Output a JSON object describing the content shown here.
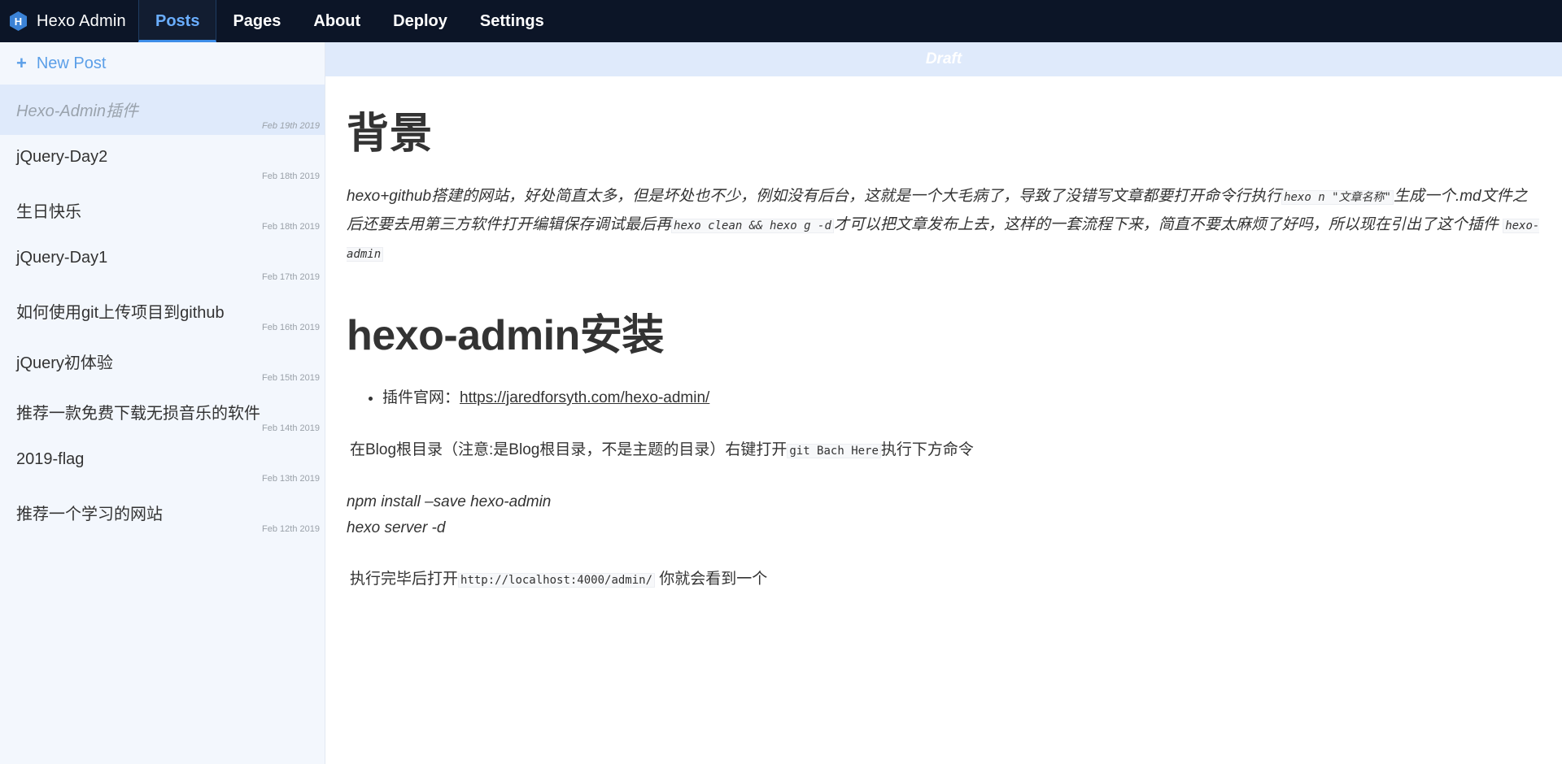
{
  "app": {
    "title": "Hexo Admin"
  },
  "nav": {
    "items": [
      "Posts",
      "Pages",
      "About",
      "Deploy",
      "Settings"
    ],
    "active": "Posts"
  },
  "sidebar": {
    "new_post_label": "New Post",
    "posts": [
      {
        "title": "Hexo-Admin插件",
        "date": "Feb 19th 2019",
        "selected": true
      },
      {
        "title": "jQuery-Day2",
        "date": "Feb 18th 2019"
      },
      {
        "title": "生日快乐",
        "date": "Feb 18th 2019"
      },
      {
        "title": "jQuery-Day1",
        "date": "Feb 17th 2019"
      },
      {
        "title": "如何使用git上传项目到github",
        "date": "Feb 16th 2019"
      },
      {
        "title": "jQuery初体验",
        "date": "Feb 15th 2019"
      },
      {
        "title": "推荐一款免费下载无损音乐的软件",
        "date": "Feb 14th 2019"
      },
      {
        "title": "2019-flag",
        "date": "Feb 13th 2019"
      },
      {
        "title": "推荐一个学习的网站",
        "date": "Feb 12th 2019"
      }
    ]
  },
  "editor": {
    "status": "Draft",
    "heading1": "背景",
    "paragraph": {
      "t1": "hexo+github搭建的网站，好处简直太多，但是坏处也不少，例如没有后台，这就是一个大毛病了，导致了没错写文章都要打开命令行执行",
      "c1": "hexo n \"文章名称\"",
      "t2": "生成一个.md文件之后还要去用第三方软件打开编辑保存调试最后再",
      "c2": "hexo clean && hexo g -d",
      "t3": "才可以把文章发布上去，这样的一套流程下来，简直不要太麻烦了好吗，所以现在引出了这个插件",
      "c3": "hexo-admin"
    },
    "heading2": "hexo-admin安装",
    "bullet": {
      "label": "插件官网：",
      "url": "https://jaredforsyth.com/hexo-admin/"
    },
    "instruction": {
      "t1": "在Blog根目录（注意:是Blog根目录，不是主题的目录）右键打开",
      "c1": "git Bach Here",
      "t2": "执行下方命令"
    },
    "commands": [
      "npm install –save hexo-admin",
      "hexo server -d"
    ],
    "after": {
      "t1": "执行完毕后打开",
      "c1": "http://localhost:4000/admin/",
      "t2": " 你就会看到一个"
    }
  },
  "colors": {
    "topbar": "#0c1527",
    "accent": "#5b9fe8",
    "sidebar_bg": "#f3f7fd",
    "selected_bg": "#dfeafb"
  }
}
